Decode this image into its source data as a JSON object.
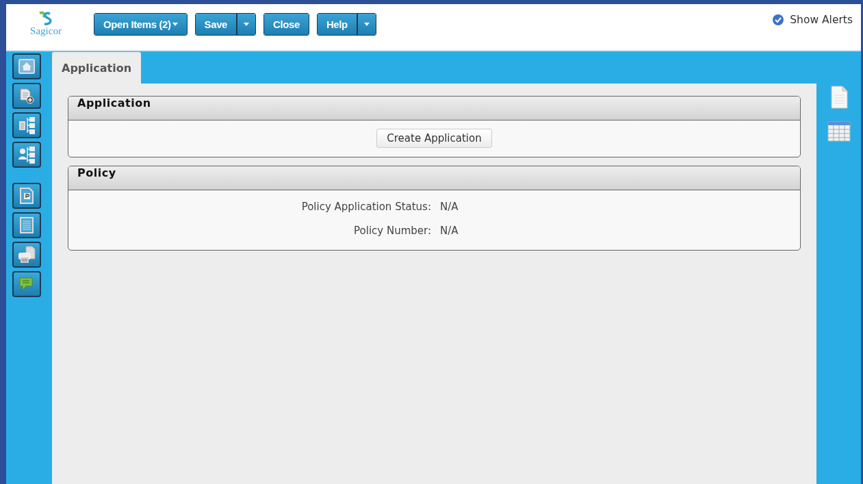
{
  "header": {
    "logo": "Sagicor",
    "toolbar": [
      {
        "kind": "menu",
        "label": "Open Items (2)"
      },
      {
        "kind": "split",
        "label": "Save"
      },
      {
        "kind": "plain",
        "label": "Close"
      },
      {
        "kind": "split",
        "label": "Help"
      }
    ],
    "alerts": {
      "label": "Show Alerts",
      "checked": true
    }
  },
  "tabs": [
    {
      "label": "Application",
      "selected": true
    }
  ],
  "sections": [
    {
      "kind": "action",
      "title": "Application",
      "button": "Create Application"
    },
    {
      "kind": "fields",
      "title": "Policy",
      "fields": [
        {
          "label": "Policy Application Status:",
          "value": "N/A"
        },
        {
          "label": "Policy Number:",
          "value": "N/A"
        }
      ]
    }
  ]
}
